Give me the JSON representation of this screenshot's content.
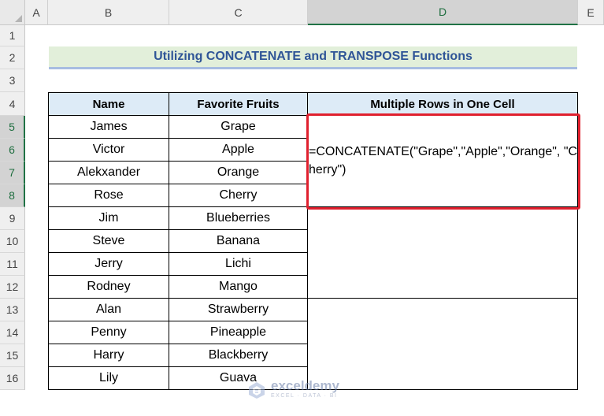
{
  "columns": [
    "A",
    "B",
    "C",
    "D",
    "E"
  ],
  "rows": [
    "1",
    "2",
    "3",
    "4",
    "5",
    "6",
    "7",
    "8",
    "9",
    "10",
    "11",
    "12",
    "13",
    "14",
    "15",
    "16"
  ],
  "title": "Utilizing CONCATENATE and TRANSPOSE Functions",
  "headers": {
    "name": "Name",
    "fruit": "Favorite Fruits",
    "result": "Multiple Rows in One Cell"
  },
  "data": [
    {
      "name": "James",
      "fruit": "Grape"
    },
    {
      "name": "Victor",
      "fruit": "Apple"
    },
    {
      "name": "Alekxander",
      "fruit": "Orange"
    },
    {
      "name": "Rose",
      "fruit": "Cherry"
    },
    {
      "name": "Jim",
      "fruit": "Blueberries"
    },
    {
      "name": "Steve",
      "fruit": "Banana"
    },
    {
      "name": "Jerry",
      "fruit": "Lichi"
    },
    {
      "name": "Rodney",
      "fruit": "Mango"
    },
    {
      "name": "Alan",
      "fruit": "Strawberry"
    },
    {
      "name": "Penny",
      "fruit": "Pineapple"
    },
    {
      "name": "Harry",
      "fruit": "Blackberry"
    },
    {
      "name": "Lily",
      "fruit": "Guava"
    }
  ],
  "formula": "=CONCATENATE(\"Grape\",\"Apple\",\"Orange\", \"Cherry\")",
  "watermark": {
    "name": "exceldemy",
    "tagline": "EXCEL · DATA · BI"
  },
  "colors": {
    "title_bg": "#e2efda",
    "title_text": "#2f5597",
    "header_bg": "#ddebf7",
    "highlight": "#e0202e",
    "active_header": "#217346"
  }
}
